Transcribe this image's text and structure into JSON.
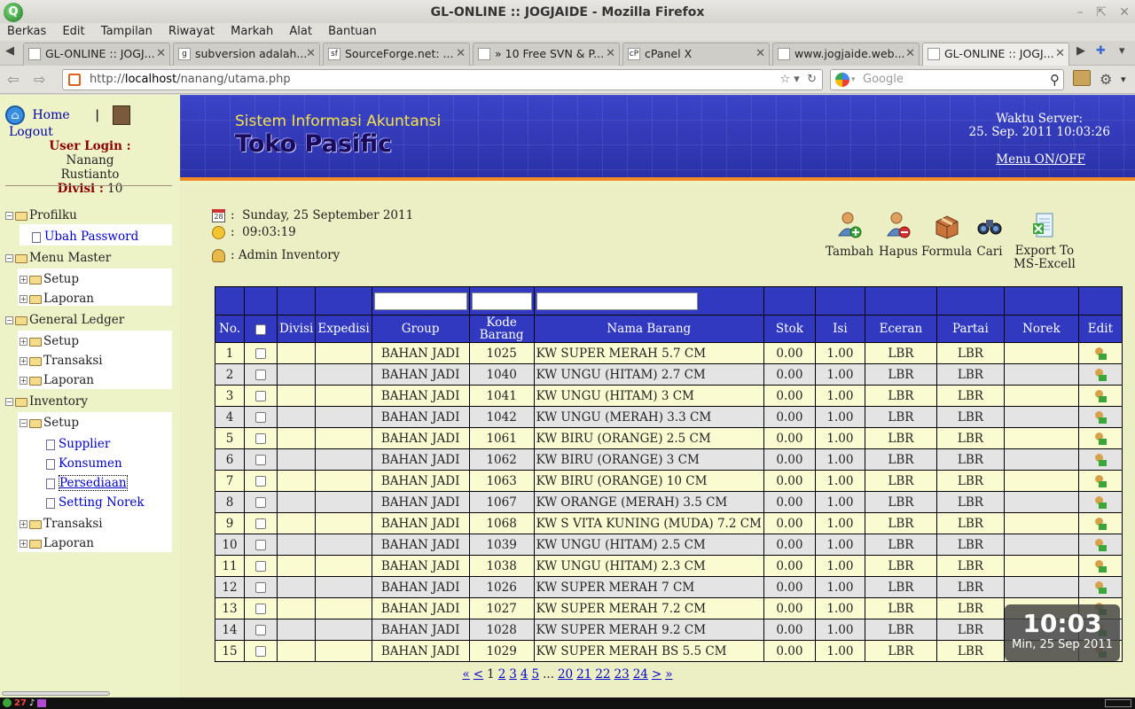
{
  "window": {
    "title": "GL-ONLINE :: JOGJAIDE - Mozilla Firefox"
  },
  "menubar": [
    "Berkas",
    "Edit",
    "Tampilan",
    "Riwayat",
    "Markah",
    "Alat",
    "Bantuan"
  ],
  "tabs": [
    {
      "label": "GL-ONLINE :: JOGJ...",
      "active": false
    },
    {
      "label": "subversion adalah...",
      "active": false
    },
    {
      "label": "SourceForge.net: ...",
      "active": false
    },
    {
      "label": "» 10 Free SVN & P...",
      "active": false
    },
    {
      "label": "cPanel X",
      "active": false
    },
    {
      "label": "www.jogjaide.web...",
      "active": false
    },
    {
      "label": "GL-ONLINE :: JOGJ...",
      "active": true
    }
  ],
  "urlbar": {
    "url_prefix": "http://",
    "url_host": "localhost",
    "url_path": "/nanang/utama.php",
    "search_placeholder": "Google"
  },
  "sidebar": {
    "home": "Home",
    "logout": "Logout",
    "user_login_label": "User Login :",
    "user_name": "Nanang Rustianto",
    "divisi_label": "Divisi :",
    "divisi_value": "10",
    "tree": {
      "profilku": "Profilku",
      "ubah_password": "Ubah Password",
      "menu_master": "Menu Master",
      "mm_setup": "Setup",
      "mm_laporan": "Laporan",
      "general_ledger": "General Ledger",
      "gl_setup": "Setup",
      "gl_transaksi": "Transaksi",
      "gl_laporan": "Laporan",
      "inventory": "Inventory",
      "inv_setup": "Setup",
      "supplier": "Supplier",
      "konsumen": "Konsumen",
      "persediaan": "Persediaan",
      "setting_norek": "Setting Norek",
      "inv_transaksi": "Transaksi",
      "inv_laporan": "Laporan"
    }
  },
  "banner": {
    "subtitle": "Sistem Informasi Akuntansi",
    "title": "Toko Pasific",
    "server_label": "Waktu Server:",
    "server_time": "25. Sep. 2011 10:03:26",
    "menu_toggle": "Menu ON/OFF"
  },
  "info": {
    "date": "Sunday, 25 September 2011",
    "time": "09:03:19",
    "role": "Admin Inventory",
    "date_icon_text": "28"
  },
  "toolbar": {
    "tambah": "Tambah",
    "hapus": "Hapus",
    "formula": "Formula",
    "cari": "Cari",
    "export_line1": "Export To",
    "export_line2": "MS-Excell"
  },
  "table": {
    "headers": {
      "no": "No.",
      "divisi": "Divisi",
      "expedisi": "Expedisi",
      "group": "Group",
      "kode1": "Kode",
      "kode2": "Barang",
      "nama": "Nama Barang",
      "stok": "Stok",
      "isi": "Isi",
      "eceran": "Eceran",
      "partai": "Partai",
      "norek": "Norek",
      "edit": "Edit"
    },
    "rows": [
      [
        "1",
        "",
        "",
        "BAHAN JADI",
        "1025",
        "KW SUPER MERAH 5.7 CM",
        "0.00",
        "1.00",
        "LBR",
        "LBR",
        ""
      ],
      [
        "2",
        "",
        "",
        "BAHAN JADI",
        "1040",
        "KW UNGU (HITAM) 2.7 CM",
        "0.00",
        "1.00",
        "LBR",
        "LBR",
        ""
      ],
      [
        "3",
        "",
        "",
        "BAHAN JADI",
        "1041",
        "KW UNGU (HITAM) 3 CM",
        "0.00",
        "1.00",
        "LBR",
        "LBR",
        ""
      ],
      [
        "4",
        "",
        "",
        "BAHAN JADI",
        "1042",
        "KW UNGU (MERAH) 3.3 CM",
        "0.00",
        "1.00",
        "LBR",
        "LBR",
        ""
      ],
      [
        "5",
        "",
        "",
        "BAHAN JADI",
        "1061",
        "KW BIRU (ORANGE) 2.5 CM",
        "0.00",
        "1.00",
        "LBR",
        "LBR",
        ""
      ],
      [
        "6",
        "",
        "",
        "BAHAN JADI",
        "1062",
        "KW BIRU (ORANGE) 3 CM",
        "0.00",
        "1.00",
        "LBR",
        "LBR",
        ""
      ],
      [
        "7",
        "",
        "",
        "BAHAN JADI",
        "1063",
        "KW BIRU (ORANGE) 10 CM",
        "0.00",
        "1.00",
        "LBR",
        "LBR",
        ""
      ],
      [
        "8",
        "",
        "",
        "BAHAN JADI",
        "1067",
        "KW ORANGE (MERAH) 3.5 CM",
        "0.00",
        "1.00",
        "LBR",
        "LBR",
        ""
      ],
      [
        "9",
        "",
        "",
        "BAHAN JADI",
        "1068",
        "KW S VITA KUNING (MUDA) 7.2 CM",
        "0.00",
        "1.00",
        "LBR",
        "LBR",
        ""
      ],
      [
        "10",
        "",
        "",
        "BAHAN JADI",
        "1039",
        "KW UNGU (HITAM) 2.5 CM",
        "0.00",
        "1.00",
        "LBR",
        "LBR",
        ""
      ],
      [
        "11",
        "",
        "",
        "BAHAN JADI",
        "1038",
        "KW UNGU (HITAM) 2.3 CM",
        "0.00",
        "1.00",
        "LBR",
        "LBR",
        ""
      ],
      [
        "12",
        "",
        "",
        "BAHAN JADI",
        "1026",
        "KW SUPER MERAH 7 CM",
        "0.00",
        "1.00",
        "LBR",
        "LBR",
        ""
      ],
      [
        "13",
        "",
        "",
        "BAHAN JADI",
        "1027",
        "KW SUPER MERAH 7.2 CM",
        "0.00",
        "1.00",
        "LBR",
        "LBR",
        ""
      ],
      [
        "14",
        "",
        "",
        "BAHAN JADI",
        "1028",
        "KW SUPER MERAH 9.2 CM",
        "0.00",
        "1.00",
        "LBR",
        "LBR",
        ""
      ],
      [
        "15",
        "",
        "",
        "BAHAN JADI",
        "1029",
        "KW SUPER MERAH BS 5.5 CM",
        "0.00",
        "1.00",
        "LBR",
        "LBR",
        ""
      ]
    ]
  },
  "pager": {
    "first": "«",
    "prev": "<",
    "current": "1",
    "pages_a": [
      "2",
      "3",
      "4",
      "5"
    ],
    "ellipsis": "...",
    "pages_b": [
      "20",
      "21",
      "22",
      "23",
      "24"
    ],
    "next": ">",
    "last": "»"
  },
  "clock": {
    "time": "10:03",
    "date": "Min, 25 Sep 2011"
  },
  "taskbar": {
    "badge": "27"
  },
  "colors": {
    "header_blue": "#3039c0",
    "banner_orange": "#f08a24",
    "page_bg": "#eef3c7",
    "row_odd": "#fbfbd2",
    "row_even": "#e4e4e4"
  }
}
